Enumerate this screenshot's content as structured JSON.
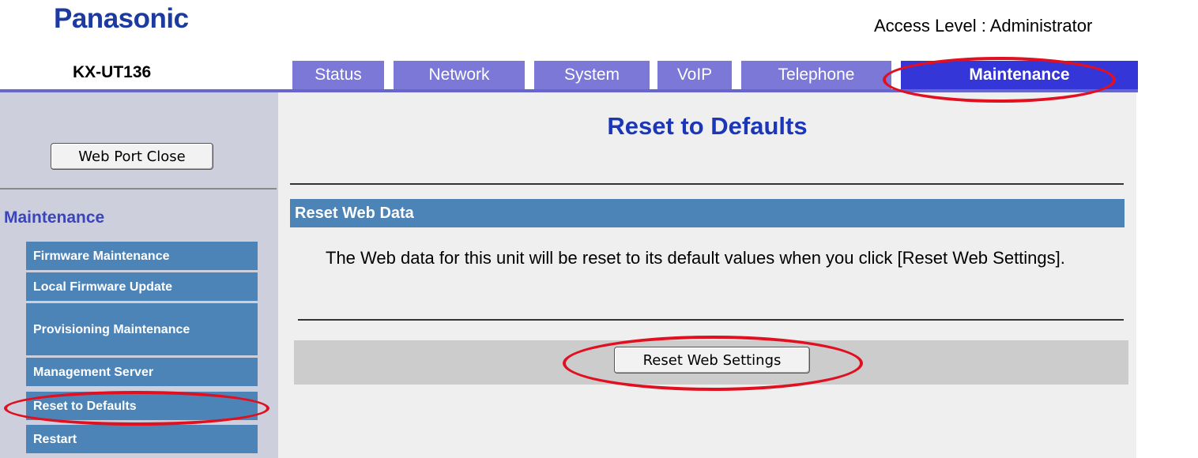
{
  "header": {
    "logo": "Panasonic",
    "access_level": "Access Level : Administrator",
    "model": "KX-UT136"
  },
  "tabs": [
    {
      "label": "Status",
      "active": false
    },
    {
      "label": "Network",
      "active": false
    },
    {
      "label": "System",
      "active": false
    },
    {
      "label": "VoIP",
      "active": false
    },
    {
      "label": "Telephone",
      "active": false
    },
    {
      "label": "Maintenance",
      "active": true
    }
  ],
  "sidebar": {
    "web_port_close_label": "Web Port Close",
    "heading": "Maintenance",
    "items": [
      {
        "label": "Firmware Maintenance"
      },
      {
        "label": "Local Firmware Update"
      },
      {
        "label": "Provisioning Maintenance"
      },
      {
        "label": "Management Server"
      },
      {
        "label": "Reset to Defaults"
      },
      {
        "label": "Restart"
      }
    ]
  },
  "main": {
    "title": "Reset to Defaults",
    "section_title": "Reset Web Data",
    "description": "The Web data for this unit will be reset to its default values when you click [Reset Web Settings].",
    "reset_button_label": "Reset Web Settings"
  },
  "colors": {
    "brand": "#1c3aa0",
    "tab_inactive": "#7c78d8",
    "tab_active": "#3536d8",
    "menu_item": "#4c84b8",
    "highlight_ring": "#e01020"
  }
}
